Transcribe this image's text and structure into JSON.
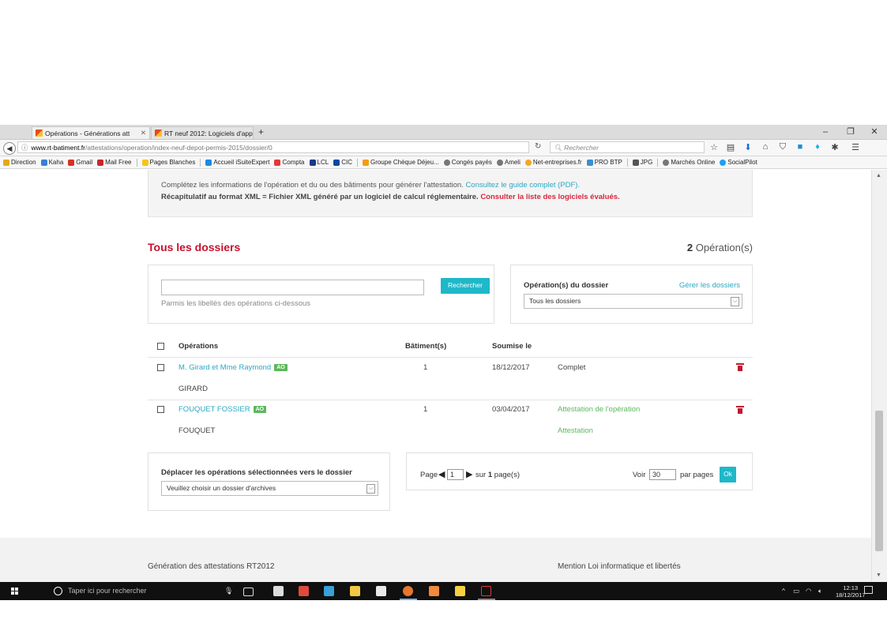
{
  "browser": {
    "tabs": [
      {
        "label": "Opérations - Générations att",
        "active": true
      },
      {
        "label": "RT neuf 2012: Logiciels d'app",
        "active": false
      }
    ],
    "new_tab": "+",
    "window_controls": [
      "–",
      "❐",
      "✕"
    ],
    "url_host": "www.rt-batiment.fr",
    "url_path": "/attestations/operation/index-neuf-depot-permis-2015/dossier/0",
    "search_placeholder": "Rechercher",
    "bookmarks": [
      "Direction",
      "Kaha",
      "Gmail",
      "Mail Free",
      "Pages Blanches",
      "Accueil iSuiteExpert",
      "Compta",
      "LCL",
      "CIC",
      "Groupe Chèque Déjeu...",
      "Congés payés",
      "Ameli",
      "Net-entreprises.fr",
      "PRO BTP",
      "JPG",
      "Marchés Online",
      "SocialPilot"
    ]
  },
  "info": {
    "line1_text": "Complétez les informations de l'opération et du ou des bâtiments pour générer l'attestation.",
    "line1_link": "Consultez le guide complet (PDF).",
    "line2_text": "Récapitulatif au format XML = Fichier XML généré par un logiciel de calcul réglementaire.",
    "line2_link": "Consulter la liste des logiciels évalués."
  },
  "section": {
    "title": "Tous les dossiers",
    "count_number": "2",
    "count_label": "Opération(s)"
  },
  "search": {
    "value": "",
    "button": "Rechercher",
    "hint": "Parmis les libellés des opérations ci-dessous"
  },
  "dossier_filter": {
    "label": "Opération(s) du dossier",
    "manage_link": "Gérer les dossiers",
    "selected": "Tous les dossiers"
  },
  "table": {
    "headers": [
      "Opérations",
      "Bâtiment(s)",
      "Soumise le"
    ],
    "badge": "AO",
    "rows": [
      {
        "name": "M. Girard et Mme Raymond",
        "buildings": "1",
        "date": "18/12/2017",
        "status": "Complet",
        "sub_name": "GIRARD",
        "sub_status": ""
      },
      {
        "name": "FOUQUET FOSSIER",
        "buildings": "1",
        "date": "03/04/2017",
        "status": "Attestation de l'opération",
        "sub_name": "FOUQUET",
        "sub_status": "Attestation"
      }
    ]
  },
  "move": {
    "label": "Déplacer les opérations sélectionnées vers le dossier",
    "placeholder": "Veuillez choisir un dossier d'archives"
  },
  "pagination": {
    "page_label": "Page",
    "page_value": "1",
    "sur": "sur",
    "total": "1",
    "pages_label": "page(s)",
    "voir": "Voir",
    "per_page": "30",
    "par_pages": "par pages",
    "ok": "Ok"
  },
  "footer": {
    "left": "Génération des attestations RT2012",
    "right": "Mention Loi informatique et libertés"
  },
  "taskbar": {
    "search": "Taper ici pour rechercher",
    "time": "12:13",
    "date": "18/12/2017"
  }
}
